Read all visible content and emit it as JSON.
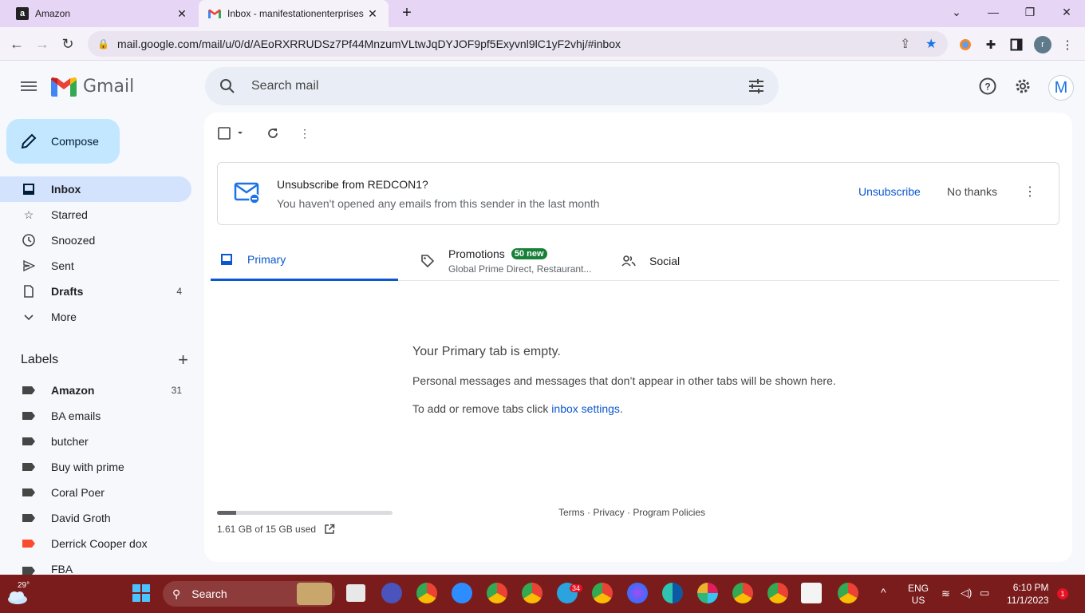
{
  "browser": {
    "tabs": [
      {
        "title": "Amazon",
        "favicon": "amazon-favicon"
      },
      {
        "title": "Inbox - manifestationenterprises",
        "favicon": "gmail-favicon"
      }
    ],
    "url": "mail.google.com/mail/u/0/d/AEoRXRRUDSz7Pf44MnzumVLtwJqDYJOF9pf5Exyvnl9lC1yF2vhj/#inbox",
    "profile_initial": "r"
  },
  "gmail": {
    "logo_text": "Gmail",
    "search_placeholder": "Search mail",
    "avatar_initial": "M",
    "compose_label": "Compose",
    "nav": [
      {
        "label": "Inbox",
        "count": "",
        "icon": "inbox-icon"
      },
      {
        "label": "Starred",
        "count": "",
        "icon": "star-icon"
      },
      {
        "label": "Snoozed",
        "count": "",
        "icon": "clock-icon"
      },
      {
        "label": "Sent",
        "count": "",
        "icon": "send-icon"
      },
      {
        "label": "Drafts",
        "count": "4",
        "icon": "draft-icon"
      },
      {
        "label": "More",
        "count": "",
        "icon": "chevron-down-icon"
      }
    ],
    "labels_title": "Labels",
    "labels": [
      {
        "label": "Amazon",
        "count": "31",
        "color": "#444746"
      },
      {
        "label": "BA emails",
        "count": "",
        "color": "#444746"
      },
      {
        "label": "butcher",
        "count": "",
        "color": "#444746"
      },
      {
        "label": "Buy with prime",
        "count": "",
        "color": "#444746"
      },
      {
        "label": "Coral Poer",
        "count": "",
        "color": "#444746"
      },
      {
        "label": "David Groth",
        "count": "",
        "color": "#444746"
      },
      {
        "label": "Derrick Cooper dox",
        "count": "",
        "color": "#fb4c2f"
      },
      {
        "label": "FBA",
        "count": "",
        "color": "#444746"
      }
    ],
    "banner": {
      "title": "Unsubscribe from REDCON1?",
      "subtitle": "You haven't opened any emails from this sender in the last month",
      "unsubscribe": "Unsubscribe",
      "no_thanks": "No thanks"
    },
    "inbox_tabs": {
      "primary": "Primary",
      "promotions": "Promotions",
      "promotions_badge": "50 new",
      "promotions_sub": "Global Prime Direct, Restaurant...",
      "social": "Social"
    },
    "empty": {
      "title": "Your Primary tab is empty.",
      "line1": "Personal messages and messages that don’t appear in other tabs will be shown here.",
      "line2_prefix": "To add or remove tabs click ",
      "line2_link": "inbox settings",
      "line2_suffix": "."
    },
    "storage": {
      "text": "1.61 GB of 15 GB used",
      "used_fraction": 0.107
    },
    "footer": "Terms · Privacy · Program Policies"
  },
  "taskbar": {
    "temperature": "29°",
    "search": "Search",
    "lang": "ENG",
    "region": "US",
    "time": "6:10 PM",
    "date": "11/1/2023",
    "notifications": "1",
    "telegram_badge": "34"
  },
  "colors": {
    "accent": "#0b57d0",
    "compose_bg": "#c2e7ff",
    "active_nav": "#d3e3fd",
    "badge_green": "#188038",
    "taskbar": "#7a1c1c"
  }
}
